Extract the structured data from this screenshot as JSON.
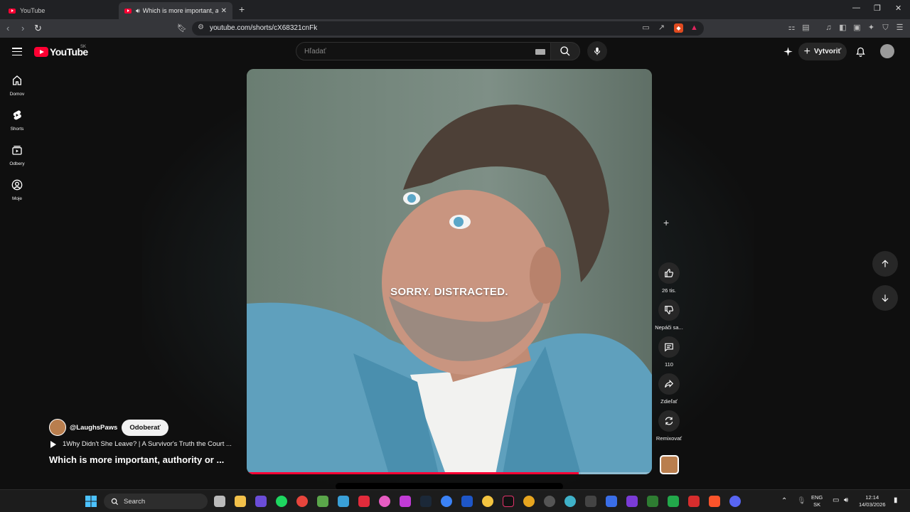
{
  "browser": {
    "tabs": [
      {
        "title": "YouTube",
        "active": false
      },
      {
        "title": "Which is more important, auth",
        "active": true
      }
    ],
    "url": "youtube.com/shorts/cX68321cnFk"
  },
  "header": {
    "logo_text": "YouTube",
    "region": "SK",
    "search_placeholder": "Hľadať",
    "create_label": "Vytvoriť"
  },
  "sidebar": {
    "items": [
      {
        "label": "Domov",
        "icon": "home-icon"
      },
      {
        "label": "Shorts",
        "icon": "shorts-icon"
      },
      {
        "label": "Odbery",
        "icon": "subscriptions-icon"
      },
      {
        "label": "Moje",
        "icon": "you-icon"
      }
    ]
  },
  "video": {
    "caption": "SORRY. DISTRACTED.",
    "progress": 0.82,
    "channel": "@LaughsPaws",
    "subscribe_label": "Odoberať",
    "linked_video": "1Why Didn't She Leave? | A Survivor's Truth the Court ...",
    "title": "Which is more important, authority or ..."
  },
  "actions": {
    "likes": "26 tis.",
    "dislike": "Nepáči sa...",
    "comments": "110",
    "share": "Zdieľať",
    "remix": "Remixovať"
  },
  "taskbar": {
    "search_label": "Search",
    "lang1": "ENG",
    "lang2": "SK",
    "time": "12:14",
    "date": "14/03/2026"
  },
  "colors": {
    "accent": "#ff0033",
    "background": "#0f0f0f",
    "button": "#272727"
  }
}
